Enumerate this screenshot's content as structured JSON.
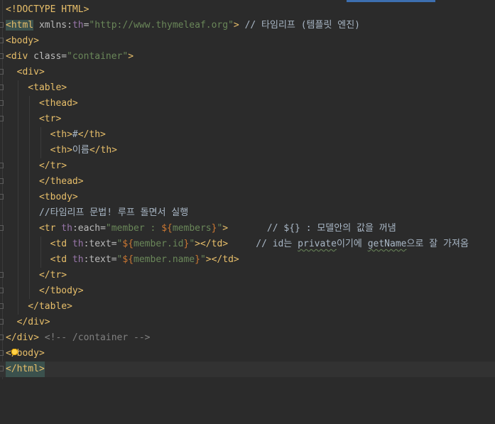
{
  "lines": [
    {
      "kind": "doctype",
      "text": "<!DOCTYPE HTML>"
    },
    {
      "kind": "html_open",
      "open": "<html",
      "attr": " xmlns:",
      "ns": "th",
      "eq": "=",
      "val": "\"http://www.thymeleaf.org\"",
      "close": ">",
      "comment": " // 타임리프 (템플릿 엔진)"
    },
    {
      "kind": "tag",
      "text": "<body>"
    },
    {
      "kind": "div_container",
      "open": "<div",
      "attr": " class=",
      "val": "\"container\"",
      "close": ">"
    },
    {
      "kind": "tag",
      "text": "  <div>"
    },
    {
      "kind": "tag",
      "text": "    <table>"
    },
    {
      "kind": "tag",
      "text": "      <thead>"
    },
    {
      "kind": "tag",
      "text": "      <tr>"
    },
    {
      "kind": "th",
      "open": "        <th>",
      "content": "#",
      "close": "</th>"
    },
    {
      "kind": "th",
      "open": "        <th>",
      "content": "이름",
      "close": "</th>"
    },
    {
      "kind": "tag",
      "text": "      </tr>"
    },
    {
      "kind": "tag",
      "text": "      </thead>"
    },
    {
      "kind": "tag",
      "text": "      <tbody>"
    },
    {
      "kind": "comment_kor",
      "text": "      //타임리프 문법! 루프 돌면서 실행"
    },
    {
      "kind": "tr_each",
      "open": "      <tr",
      "ns": " th",
      "attr": ":each=",
      "q1": "\"",
      "v1": "member : ",
      "ob": "${",
      "v2": "members",
      "cb": "}",
      "q2": "\"",
      "close": ">",
      "comment": "       // ${} : 모델안의 값을 꺼냄"
    },
    {
      "kind": "td",
      "open": "        <td",
      "ns": " th",
      "attr": ":text=",
      "q1": "\"",
      "ob": "${",
      "v": "member.id",
      "cb": "}",
      "q2": "\"",
      "close": "></td>",
      "comment_a": "     // id는 ",
      "comment_b": "private",
      "comment_c": "이기에 ",
      "comment_d": "getName",
      "comment_e": "으로 잘 가져옴"
    },
    {
      "kind": "td2",
      "open": "        <td",
      "ns": " th",
      "attr": ":text=",
      "q1": "\"",
      "ob": "${",
      "v": "member.name",
      "cb": "}",
      "q2": "\"",
      "close": "></td>"
    },
    {
      "kind": "tag",
      "text": "      </tr>"
    },
    {
      "kind": "tag",
      "text": "      </tbody>"
    },
    {
      "kind": "tag",
      "text": "    </table>"
    },
    {
      "kind": "tag",
      "text": "  </div>"
    },
    {
      "kind": "div_close",
      "tag": "</div>",
      "comment": " <!-- /container -->"
    },
    {
      "kind": "body_close",
      "text_a": "</",
      "text_b": "body>"
    },
    {
      "kind": "html_close",
      "text": "</html>"
    }
  ]
}
